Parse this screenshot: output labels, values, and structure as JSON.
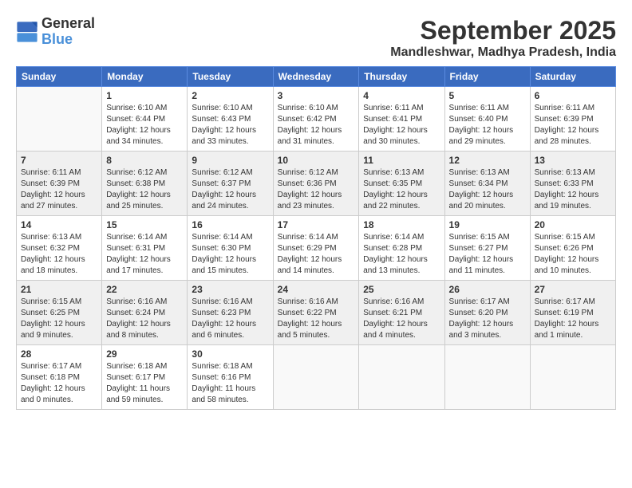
{
  "header": {
    "logo_general": "General",
    "logo_blue": "Blue",
    "month": "September 2025",
    "location": "Mandleshwar, Madhya Pradesh, India"
  },
  "days_of_week": [
    "Sunday",
    "Monday",
    "Tuesday",
    "Wednesday",
    "Thursday",
    "Friday",
    "Saturday"
  ],
  "weeks": [
    [
      {
        "day": "",
        "text": ""
      },
      {
        "day": "1",
        "text": "Sunrise: 6:10 AM\nSunset: 6:44 PM\nDaylight: 12 hours\nand 34 minutes."
      },
      {
        "day": "2",
        "text": "Sunrise: 6:10 AM\nSunset: 6:43 PM\nDaylight: 12 hours\nand 33 minutes."
      },
      {
        "day": "3",
        "text": "Sunrise: 6:10 AM\nSunset: 6:42 PM\nDaylight: 12 hours\nand 31 minutes."
      },
      {
        "day": "4",
        "text": "Sunrise: 6:11 AM\nSunset: 6:41 PM\nDaylight: 12 hours\nand 30 minutes."
      },
      {
        "day": "5",
        "text": "Sunrise: 6:11 AM\nSunset: 6:40 PM\nDaylight: 12 hours\nand 29 minutes."
      },
      {
        "day": "6",
        "text": "Sunrise: 6:11 AM\nSunset: 6:39 PM\nDaylight: 12 hours\nand 28 minutes."
      }
    ],
    [
      {
        "day": "7",
        "text": "Sunrise: 6:11 AM\nSunset: 6:39 PM\nDaylight: 12 hours\nand 27 minutes."
      },
      {
        "day": "8",
        "text": "Sunrise: 6:12 AM\nSunset: 6:38 PM\nDaylight: 12 hours\nand 25 minutes."
      },
      {
        "day": "9",
        "text": "Sunrise: 6:12 AM\nSunset: 6:37 PM\nDaylight: 12 hours\nand 24 minutes."
      },
      {
        "day": "10",
        "text": "Sunrise: 6:12 AM\nSunset: 6:36 PM\nDaylight: 12 hours\nand 23 minutes."
      },
      {
        "day": "11",
        "text": "Sunrise: 6:13 AM\nSunset: 6:35 PM\nDaylight: 12 hours\nand 22 minutes."
      },
      {
        "day": "12",
        "text": "Sunrise: 6:13 AM\nSunset: 6:34 PM\nDaylight: 12 hours\nand 20 minutes."
      },
      {
        "day": "13",
        "text": "Sunrise: 6:13 AM\nSunset: 6:33 PM\nDaylight: 12 hours\nand 19 minutes."
      }
    ],
    [
      {
        "day": "14",
        "text": "Sunrise: 6:13 AM\nSunset: 6:32 PM\nDaylight: 12 hours\nand 18 minutes."
      },
      {
        "day": "15",
        "text": "Sunrise: 6:14 AM\nSunset: 6:31 PM\nDaylight: 12 hours\nand 17 minutes."
      },
      {
        "day": "16",
        "text": "Sunrise: 6:14 AM\nSunset: 6:30 PM\nDaylight: 12 hours\nand 15 minutes."
      },
      {
        "day": "17",
        "text": "Sunrise: 6:14 AM\nSunset: 6:29 PM\nDaylight: 12 hours\nand 14 minutes."
      },
      {
        "day": "18",
        "text": "Sunrise: 6:14 AM\nSunset: 6:28 PM\nDaylight: 12 hours\nand 13 minutes."
      },
      {
        "day": "19",
        "text": "Sunrise: 6:15 AM\nSunset: 6:27 PM\nDaylight: 12 hours\nand 11 minutes."
      },
      {
        "day": "20",
        "text": "Sunrise: 6:15 AM\nSunset: 6:26 PM\nDaylight: 12 hours\nand 10 minutes."
      }
    ],
    [
      {
        "day": "21",
        "text": "Sunrise: 6:15 AM\nSunset: 6:25 PM\nDaylight: 12 hours\nand 9 minutes."
      },
      {
        "day": "22",
        "text": "Sunrise: 6:16 AM\nSunset: 6:24 PM\nDaylight: 12 hours\nand 8 minutes."
      },
      {
        "day": "23",
        "text": "Sunrise: 6:16 AM\nSunset: 6:23 PM\nDaylight: 12 hours\nand 6 minutes."
      },
      {
        "day": "24",
        "text": "Sunrise: 6:16 AM\nSunset: 6:22 PM\nDaylight: 12 hours\nand 5 minutes."
      },
      {
        "day": "25",
        "text": "Sunrise: 6:16 AM\nSunset: 6:21 PM\nDaylight: 12 hours\nand 4 minutes."
      },
      {
        "day": "26",
        "text": "Sunrise: 6:17 AM\nSunset: 6:20 PM\nDaylight: 12 hours\nand 3 minutes."
      },
      {
        "day": "27",
        "text": "Sunrise: 6:17 AM\nSunset: 6:19 PM\nDaylight: 12 hours\nand 1 minute."
      }
    ],
    [
      {
        "day": "28",
        "text": "Sunrise: 6:17 AM\nSunset: 6:18 PM\nDaylight: 12 hours\nand 0 minutes."
      },
      {
        "day": "29",
        "text": "Sunrise: 6:18 AM\nSunset: 6:17 PM\nDaylight: 11 hours\nand 59 minutes."
      },
      {
        "day": "30",
        "text": "Sunrise: 6:18 AM\nSunset: 6:16 PM\nDaylight: 11 hours\nand 58 minutes."
      },
      {
        "day": "",
        "text": ""
      },
      {
        "day": "",
        "text": ""
      },
      {
        "day": "",
        "text": ""
      },
      {
        "day": "",
        "text": ""
      }
    ]
  ]
}
